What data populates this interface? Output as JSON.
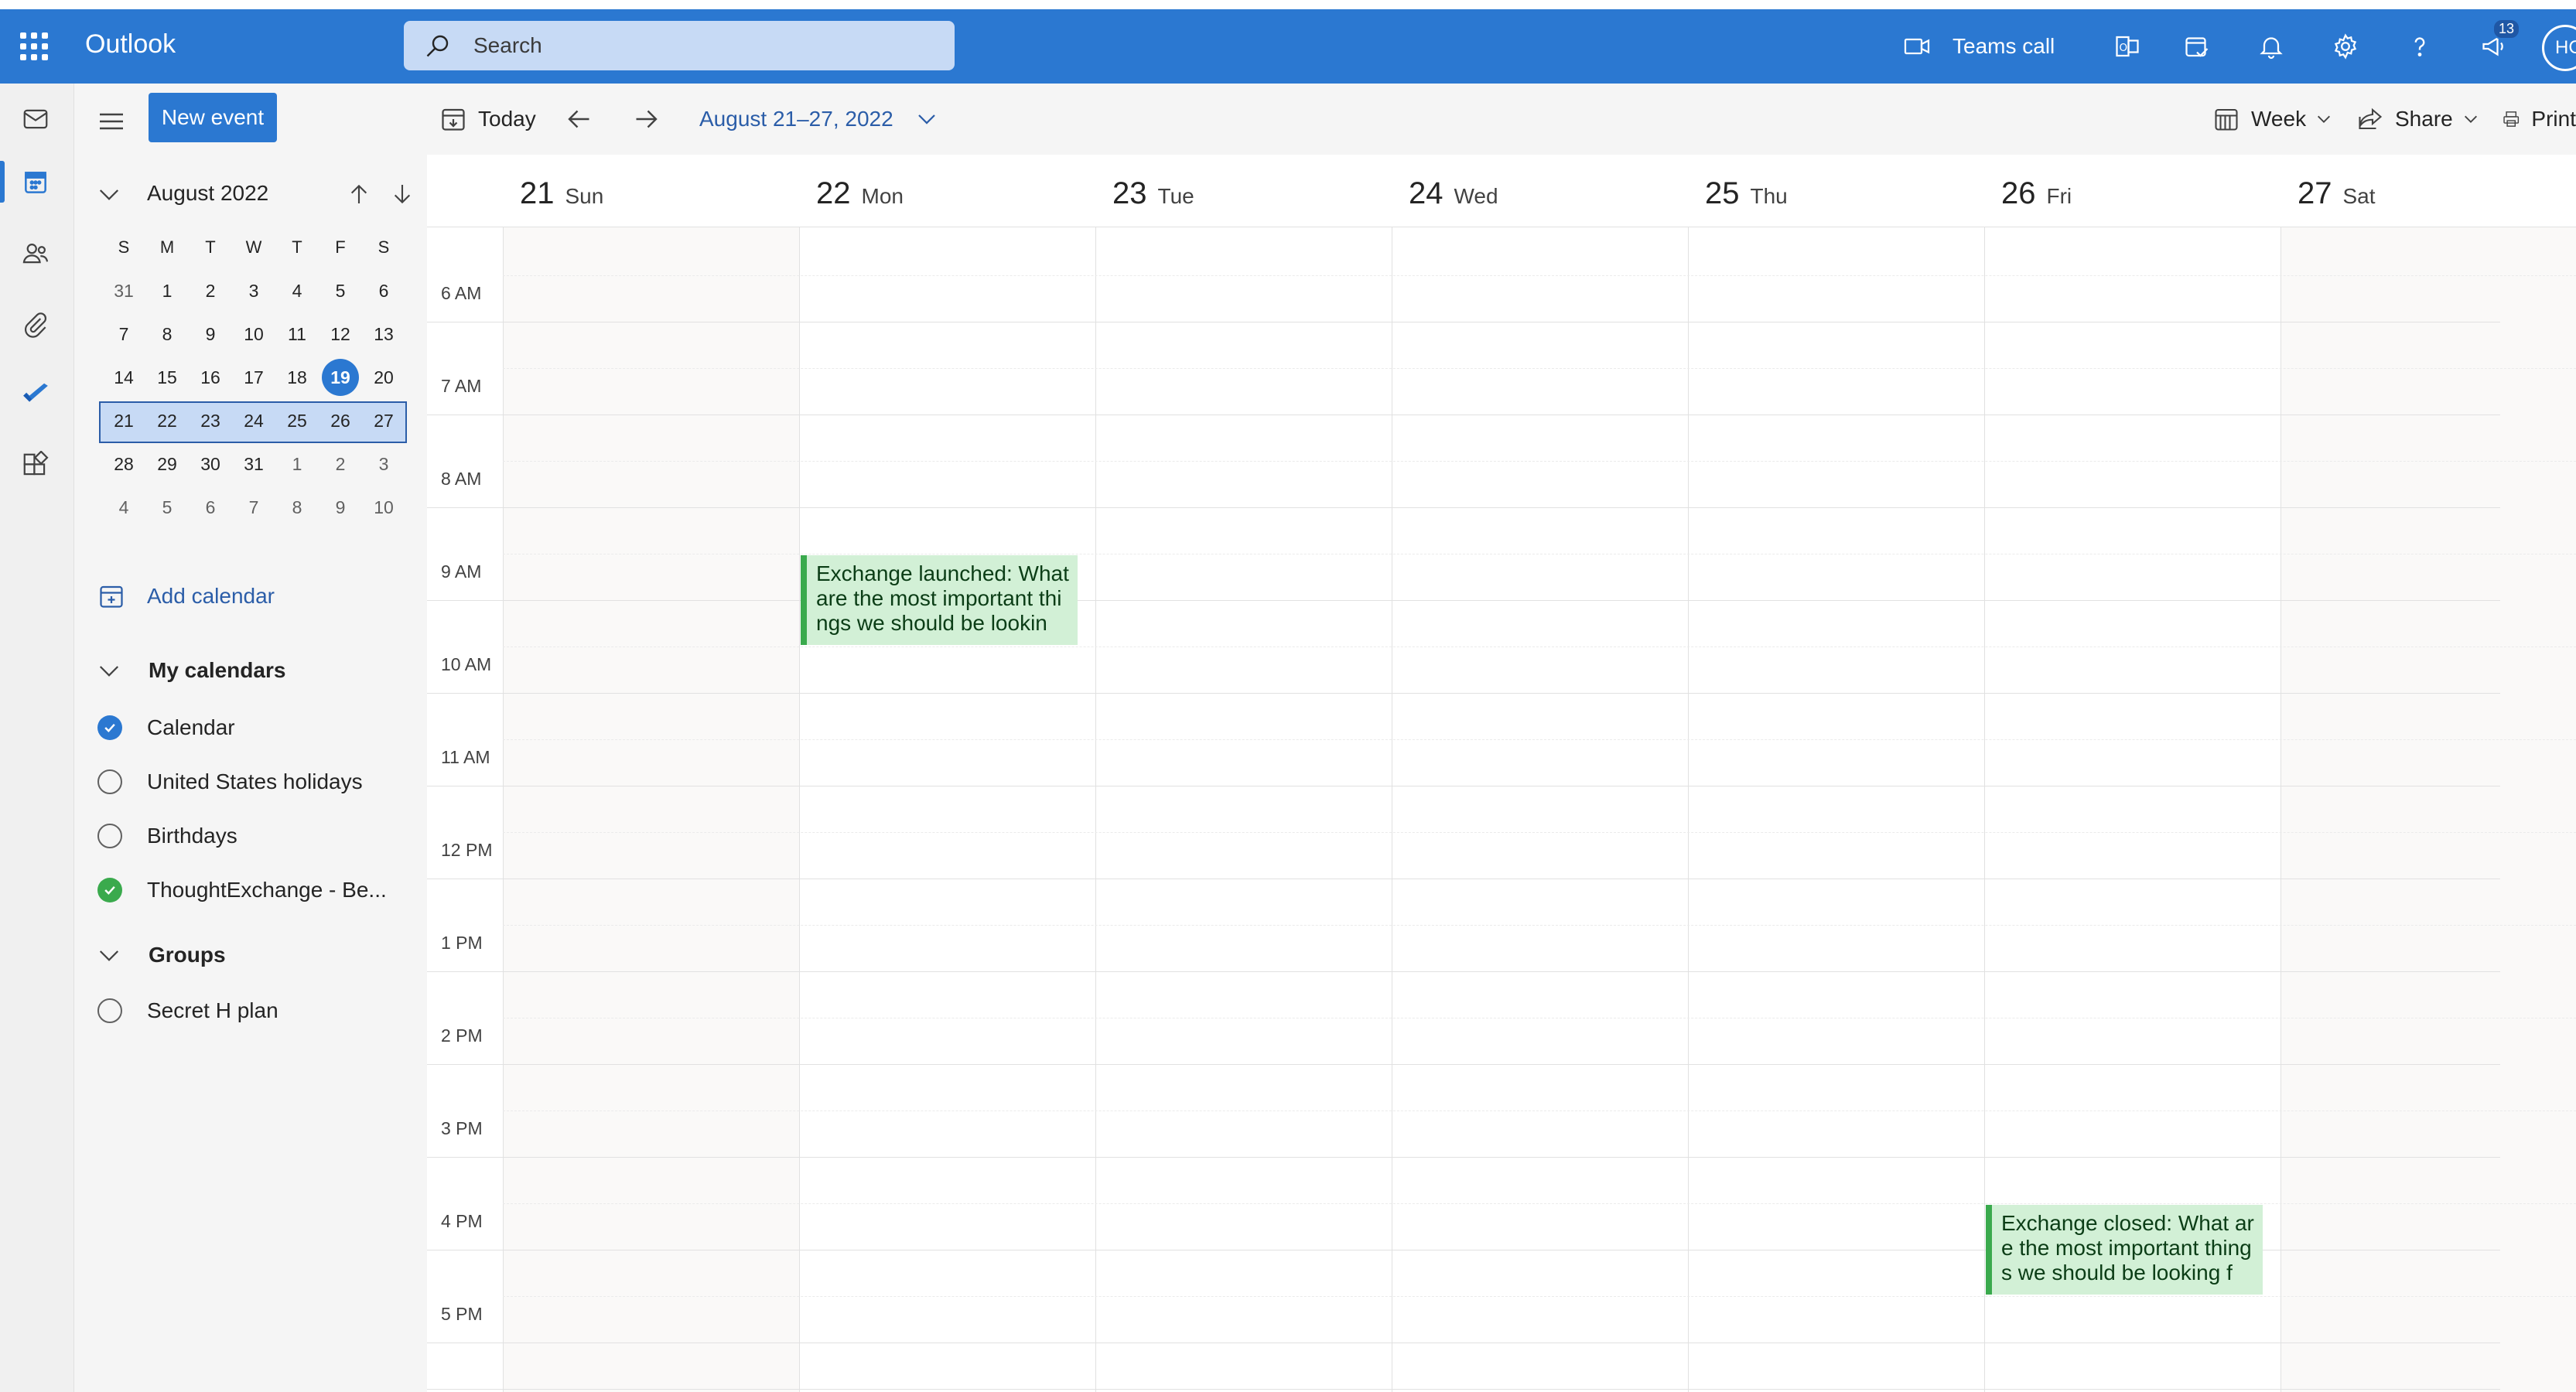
{
  "header": {
    "app_name": "Outlook",
    "search_placeholder": "Search",
    "teams_call_label": "Teams call",
    "notification_badge": "13",
    "avatar_initials": "HC"
  },
  "left_rail": {
    "items": [
      "mail-icon",
      "calendar-icon",
      "people-icon",
      "attachment-icon",
      "todo-icon",
      "apps-icon"
    ]
  },
  "sidebar": {
    "new_event_label": "New event",
    "mini_calendar": {
      "month_label": "August 2022",
      "weekday_headers": [
        "S",
        "M",
        "T",
        "W",
        "T",
        "F",
        "S"
      ],
      "weeks": [
        [
          "31",
          "1",
          "2",
          "3",
          "4",
          "5",
          "6"
        ],
        [
          "7",
          "8",
          "9",
          "10",
          "11",
          "12",
          "13"
        ],
        [
          "14",
          "15",
          "16",
          "17",
          "18",
          "19",
          "20"
        ],
        [
          "21",
          "22",
          "23",
          "24",
          "25",
          "26",
          "27"
        ],
        [
          "28",
          "29",
          "30",
          "31",
          "1",
          "2",
          "3"
        ],
        [
          "4",
          "5",
          "6",
          "7",
          "8",
          "9",
          "10"
        ]
      ],
      "today": "19",
      "selected_week_index": 3
    },
    "add_calendar_label": "Add calendar",
    "my_calendars_label": "My calendars",
    "calendars": [
      {
        "name": "Calendar",
        "checked": true,
        "color": "#2b78d1"
      },
      {
        "name": "United States holidays",
        "checked": false,
        "color": "#616161"
      },
      {
        "name": "Birthdays",
        "checked": false,
        "color": "#616161"
      },
      {
        "name": "ThoughtExchange - Be...",
        "checked": true,
        "color": "#3aaa4d"
      }
    ],
    "groups_label": "Groups",
    "groups": [
      {
        "name": "Secret H plan",
        "checked": false
      }
    ]
  },
  "toolbar": {
    "today_label": "Today",
    "range_label": "August 21–27, 2022",
    "view_label": "Week",
    "share_label": "Share",
    "print_label": "Print"
  },
  "week": {
    "days": [
      {
        "num": "21",
        "name": "Sun"
      },
      {
        "num": "22",
        "name": "Mon"
      },
      {
        "num": "23",
        "name": "Tue"
      },
      {
        "num": "24",
        "name": "Wed"
      },
      {
        "num": "25",
        "name": "Thu"
      },
      {
        "num": "26",
        "name": "Fri"
      },
      {
        "num": "27",
        "name": "Sat"
      }
    ],
    "time_labels": [
      "6 AM",
      "7 AM",
      "8 AM",
      "9 AM",
      "10 AM",
      "11 AM",
      "12 PM",
      "1 PM",
      "2 PM",
      "3 PM",
      "4 PM",
      "5 PM"
    ]
  },
  "events": [
    {
      "title": "Exchange launched: What are the most important things we should be lookin",
      "day": "22",
      "start": "9 AM",
      "duration_hours": 1
    },
    {
      "title": "Exchange closed: What are the most important things we should be looking f",
      "day": "26",
      "start": "4 PM",
      "duration_hours": 1
    }
  ],
  "colors": {
    "brand": "#2b78d1",
    "event_fill": "#d2f0d6",
    "event_bar": "#3aaa4d"
  }
}
